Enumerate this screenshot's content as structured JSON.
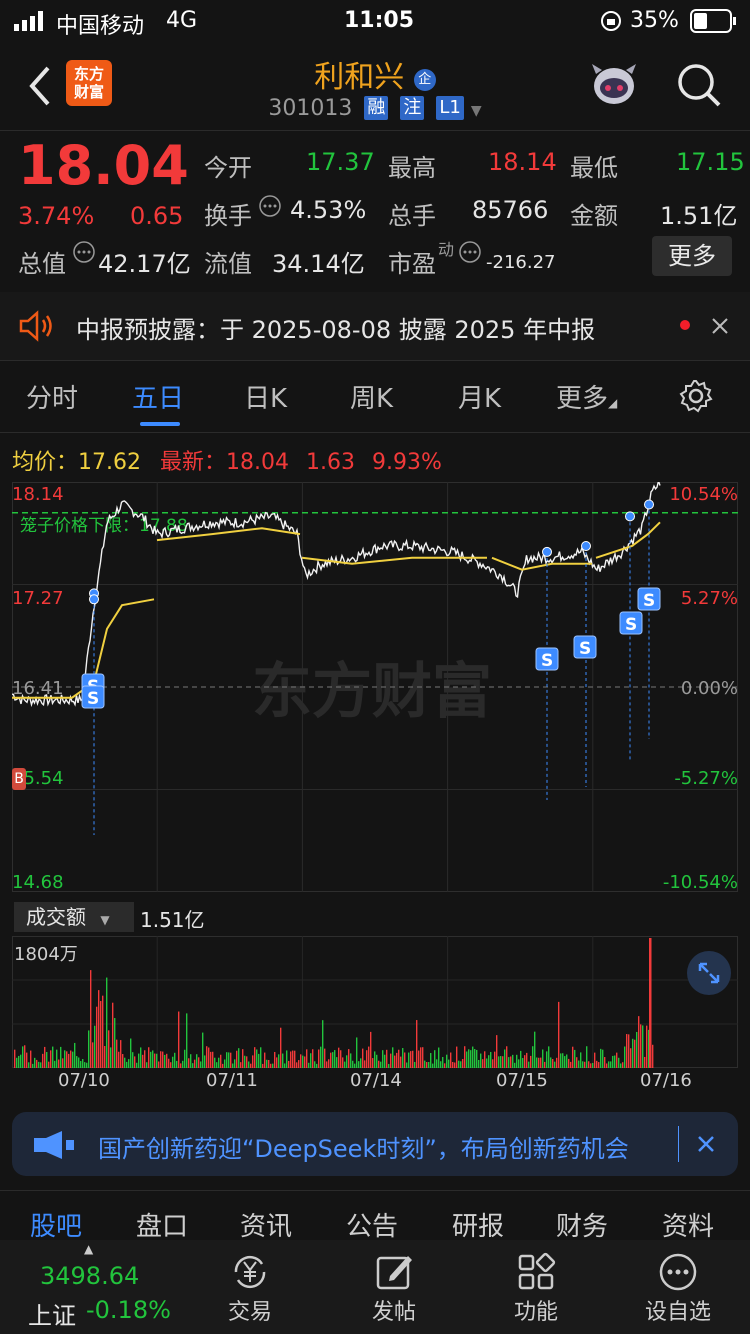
{
  "status_bar": {
    "carrier": "中国移动",
    "network": "4G",
    "time": "11:05",
    "battery": "35%"
  },
  "header": {
    "logo_text": "东方财富",
    "stock_name": "利和兴",
    "name_badge": "企",
    "stock_code": "301013",
    "tags": [
      "融",
      "注",
      "L1"
    ]
  },
  "quote": {
    "price": "18.04",
    "change_pct": "3.74%",
    "change_amt": "0.65",
    "open_label": "今开",
    "open": "17.37",
    "high_label": "最高",
    "high": "18.14",
    "low_label": "最低",
    "low": "17.15",
    "turnover_label": "换手",
    "turnover": "4.53%",
    "volume_label": "总手",
    "volume": "85766",
    "amount_label": "金额",
    "amount": "1.51亿",
    "mcap_label": "总值",
    "mcap": "42.17亿",
    "float_label": "流值",
    "float_mcap": "34.14亿",
    "pe_label": "市盈",
    "pe_sup": "动",
    "pe": "-216.27",
    "more_label": "更多"
  },
  "notice": {
    "text": "中报预披露：于 2025-08-08 披露 2025 年中报"
  },
  "tabs": [
    {
      "label": "分时"
    },
    {
      "label": "五日"
    },
    {
      "label": "日K"
    },
    {
      "label": "周K"
    },
    {
      "label": "月K"
    },
    {
      "label": "更多"
    }
  ],
  "chart_info": {
    "avg_label": "均价：",
    "avg": "17.62",
    "latest_label": "最新：",
    "latest": "18.04",
    "chg": "1.63",
    "chg_pct": "9.93%"
  },
  "chart_data": {
    "type": "line",
    "y_left_ticks": [
      "18.14",
      "17.27",
      "16.41",
      "15.54",
      "14.68"
    ],
    "y_right_ticks": [
      "10.54%",
      "5.27%",
      "0.00%",
      "-5.27%",
      "-10.54%"
    ],
    "ylim": [
      14.68,
      18.14
    ],
    "x_labels": [
      "07/10",
      "07/11",
      "07/14",
      "07/15",
      "07/16"
    ],
    "ref_line_label": "笼子价格下限：17.88",
    "ref_line_value": 17.88,
    "marker_label": "S",
    "buy_marker_label": "B"
  },
  "volume": {
    "selector_label": "成交额",
    "total": "1.51亿",
    "max_label": "1804万"
  },
  "ad": {
    "text": "国产创新药迎“DeepSeek时刻”，布局创新药机会"
  },
  "watermark": "东方财富",
  "sub_tabs": [
    "股吧",
    "盘口",
    "资讯",
    "公告",
    "研报",
    "财务",
    "资料"
  ],
  "bottom_nav": {
    "index_value": "3498.64",
    "index_name": "上证",
    "index_change": "-0.18%",
    "items": [
      {
        "label": "交易",
        "icon": "yen-exchange-icon"
      },
      {
        "label": "发帖",
        "icon": "edit-post-icon"
      },
      {
        "label": "功能",
        "icon": "grid-icon"
      },
      {
        "label": "设自选",
        "icon": "more-dots-icon"
      }
    ]
  },
  "colors": {
    "up": "#f23a3a",
    "down": "#22c43d",
    "accent": "#3d8bff",
    "avg_line": "#f0d040",
    "brand": "#ef5a16"
  }
}
